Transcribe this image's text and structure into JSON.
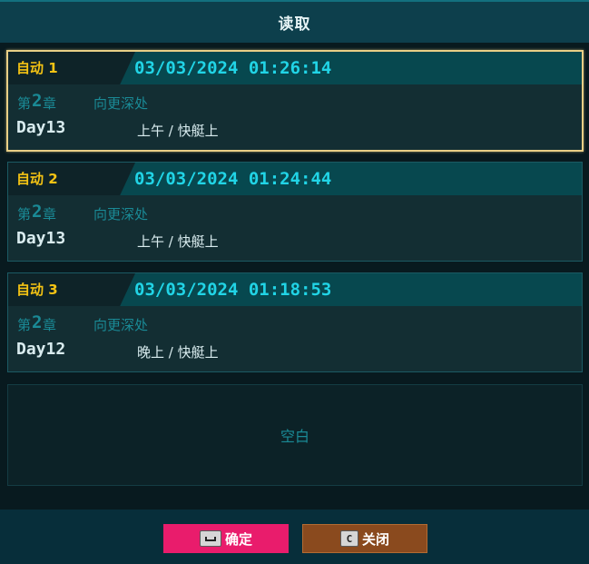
{
  "title": "读取",
  "slots": [
    {
      "label": "自动 1",
      "timestamp": "03/03/2024 01:26:14",
      "chapter_prefix": "第",
      "chapter_num": "2",
      "chapter_suffix": "章",
      "chapter_title": "向更深处",
      "day": "Day13",
      "location": "上午 / 快艇上"
    },
    {
      "label": "自动 2",
      "timestamp": "03/03/2024 01:24:44",
      "chapter_prefix": "第",
      "chapter_num": "2",
      "chapter_suffix": "章",
      "chapter_title": "向更深处",
      "day": "Day13",
      "location": "上午 / 快艇上"
    },
    {
      "label": "自动 3",
      "timestamp": "03/03/2024 01:18:53",
      "chapter_prefix": "第",
      "chapter_num": "2",
      "chapter_suffix": "章",
      "chapter_title": "向更深处",
      "day": "Day12",
      "location": "晚上 / 快艇上"
    }
  ],
  "empty_slot_text": "空白",
  "buttons": {
    "confirm": {
      "key_icon": "space-key-icon",
      "label": "确定"
    },
    "close": {
      "key": "C",
      "label": "关闭"
    }
  },
  "colors": {
    "accent_yellow": "#f4c314",
    "accent_cyan": "#21d4e6",
    "confirm_pink": "#e91c6c",
    "close_brown": "#8a4a1e",
    "selected_border": "#e8cf86"
  }
}
